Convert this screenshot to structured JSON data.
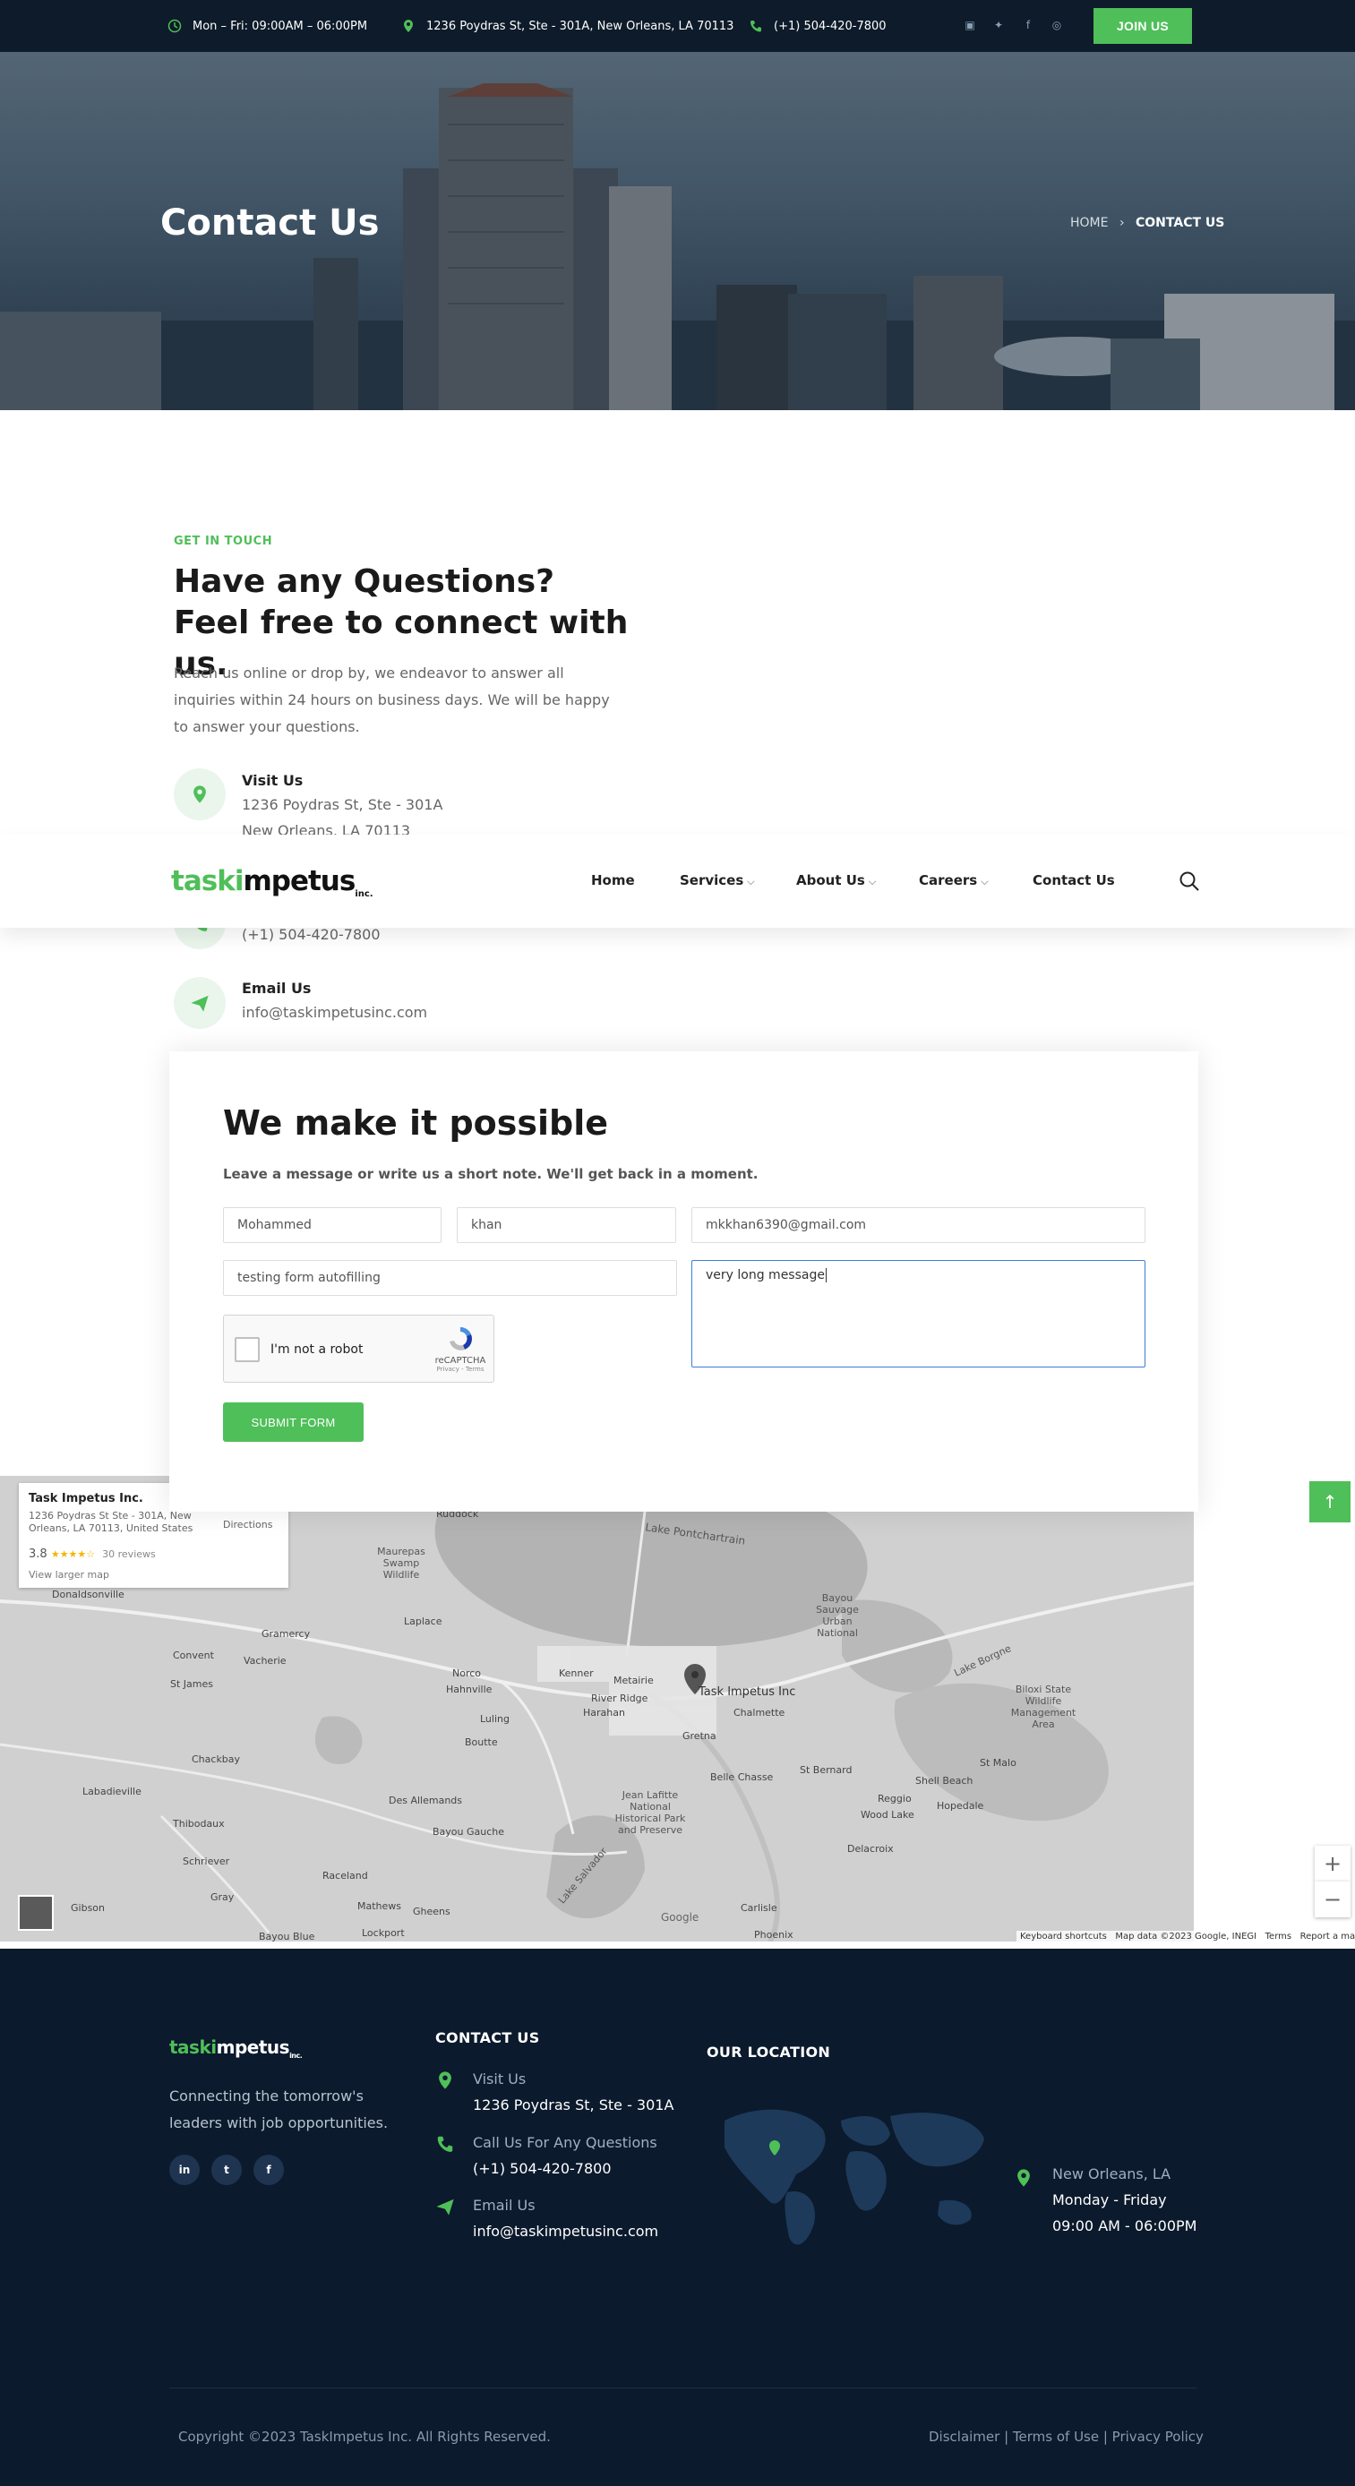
{
  "topbar": {
    "hours": "Mon – Fri: 09:00AM – 06:00PM",
    "address": "1236 Poydras St, Ste - 301A, New Orleans, LA 70113",
    "phone": "(+1) 504-420-7800",
    "join_label": "JOIN US",
    "social_icons": [
      "linkedin-icon",
      "twitter-icon",
      "facebook-icon",
      "instagram-icon"
    ]
  },
  "hero": {
    "title": "Contact Us",
    "breadcrumb_home": "HOME",
    "breadcrumb_current": "CONTACT US"
  },
  "contact": {
    "eyebrow": "GET IN TOUCH",
    "title": "Have any Questions? Feel free to connect with us.",
    "description": "Reach us online or drop by, we endeavor to answer all inquiries within 24 hours on business days. We will be happy to answer your questions.",
    "visit_title": "Visit Us",
    "visit_line1": "1236 Poydras St, Ste - 301A",
    "visit_line2": "New Orleans, LA 70113",
    "phone_value": "(+1) 504-420-7800",
    "email_title": "Email Us",
    "email_value": "info@taskimpetusinc.com"
  },
  "nav": {
    "logo_prefix": "task",
    "logo_i": "i",
    "logo_rest": "mpetus",
    "logo_suffix": "inc.",
    "items": [
      "Home",
      "Services",
      "About Us",
      "Careers",
      "Contact Us"
    ]
  },
  "form": {
    "title": "We make it possible",
    "subtitle": "Leave a message or write us a short note. We'll get back in a moment.",
    "first_name": "Mohammed",
    "last_name": "khan",
    "email": "mkkhan6390@gmail.com",
    "subject": "testing form autofilling",
    "message": "very long message",
    "captcha_label": "I'm not a robot",
    "captcha_brand": "reCAPTCHA",
    "captcha_links": "Privacy - Terms",
    "submit_label": "SUBMIT FORM"
  },
  "map": {
    "place_name": "Task Impetus Inc.",
    "place_address": "1236 Poydras St Ste - 301A, New Orleans, LA 70113, United States",
    "rating": "3.8",
    "stars": "★★★★☆",
    "reviews": "30 reviews",
    "larger_map": "View larger map",
    "directions": "Directions",
    "pin_label": "Task Impetus Inc",
    "labels": [
      "Lake Pontchartrain",
      "Maurepas Swamp Wildlife",
      "Bayou Sauvage Urban National",
      "Lake Borgne",
      "Biloxi State Wildlife Management Area",
      "Kenner",
      "Metairie",
      "Chalmette",
      "Gretna",
      "Belle Chasse",
      "Jean Lafitte National Historical Park and Preserve",
      "Des Allemands",
      "Bayou Gauche",
      "Raceland",
      "Gramercy",
      "Laplace",
      "Norco",
      "Hahnville",
      "Luling",
      "Boutte",
      "River Ridge",
      "Harahan",
      "Vacherie",
      "Convent",
      "St James",
      "Thibodaux",
      "Labadieville",
      "Schriever",
      "Gray",
      "Mathews",
      "Lockport",
      "Gheens",
      "Carlisle",
      "Phoenix",
      "St Bernard",
      "Reggio",
      "Hopedale",
      "Shell Beach",
      "Wood Lake",
      "Delacroix",
      "St Malo",
      "Lake Salvador",
      "Chackbay",
      "Donaldsonville",
      "Gibson",
      "Bayou Blue",
      "Ruddock"
    ],
    "keyboard": "Keyboard shortcuts",
    "mapdata": "Map data ©2023 Google, INEGI",
    "terms": "Terms",
    "report": "Report a map error",
    "zoom_in": "+",
    "zoom_out": "−",
    "google": "Google"
  },
  "footer": {
    "logo_prefix": "task",
    "logo_i": "i",
    "logo_rest": "mpetus",
    "logo_suffix": "inc.",
    "tagline": "Connecting the tomorrow's leaders with job opportunities.",
    "social": [
      "in",
      "t",
      "f"
    ],
    "contact_heading": "CONTACT US",
    "visit_label": "Visit Us",
    "visit_value": "1236 Poydras St, Ste - 301A",
    "call_label": "Call Us For Any Questions",
    "call_value": "(+1) 504-420-7800",
    "email_label": "Email Us",
    "email_value": "info@taskimpetusinc.com",
    "location_heading": "OUR LOCATION",
    "city": "New Orleans, LA",
    "days": "Monday - Friday",
    "hours": "09:00 AM - 06:00PM",
    "copyright": "Copyright ©2023 TaskImpetus Inc. All Rights Reserved.",
    "legal": "Disclaimer | Terms of Use | Privacy Policy"
  },
  "colors": {
    "brand_green": "#4fbf59",
    "dark_navy": "#0b1a2c",
    "topbar": "#0d1b2a"
  }
}
